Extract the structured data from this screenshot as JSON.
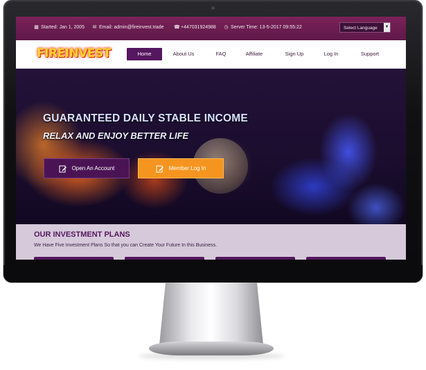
{
  "topbar": {
    "started": "Started: Jan 1, 2005",
    "email": "Email: admin@fireinvest.trade",
    "phone": "+447031924988",
    "server_time": "Server Time: 13-5-2017 09:55:22",
    "language_select": "Select Language"
  },
  "logo": {
    "text": "FIREINVEST"
  },
  "nav": {
    "items": [
      {
        "label": "Home",
        "active": true
      },
      {
        "label": "About Us"
      },
      {
        "label": "FAQ"
      },
      {
        "label": "Affiliate"
      },
      {
        "label": "Sign Up"
      },
      {
        "label": "Log In"
      },
      {
        "label": "Support"
      }
    ]
  },
  "hero": {
    "title": "GUARANTEED DAILY STABLE INCOME",
    "subtitle": "RELAX AND ENJOY BETTER LIFE",
    "open_account_label": "Open An Account",
    "member_login_label": "Member Log In"
  },
  "plans": {
    "title": "OUR INVESTMENT PLANS",
    "subtitle": "We Have Five Investment Plans So that you can Create Your Future In this Business."
  },
  "colors": {
    "brand_purple": "#55175f",
    "topbar": "#6d1f52",
    "accent_orange": "#f5951f",
    "plans_bg": "#d6c9da"
  },
  "icons": [
    "calendar-icon",
    "envelope-icon",
    "phone-icon",
    "clock-icon",
    "chevron-down-icon",
    "edit-icon"
  ]
}
